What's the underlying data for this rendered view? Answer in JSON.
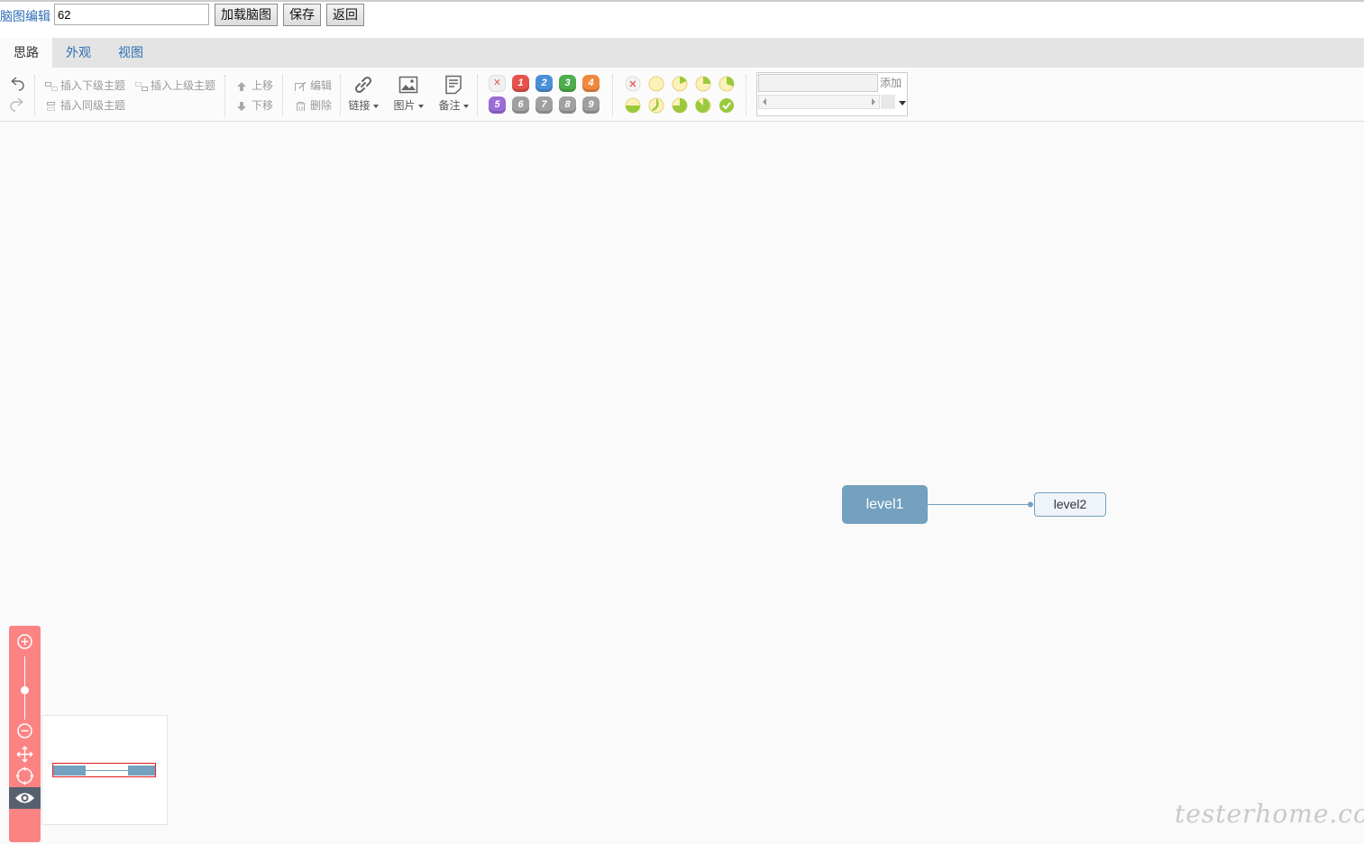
{
  "header": {
    "title": "脑图编辑",
    "id_value": "62",
    "load_button": "加载脑图",
    "save_button": "保存",
    "back_button": "返回"
  },
  "tabs": [
    {
      "label": "思路",
      "active": true
    },
    {
      "label": "外观",
      "active": false
    },
    {
      "label": "视图",
      "active": false
    }
  ],
  "toolbar": {
    "insert_child": "插入下级主题",
    "insert_parent": "插入上级主题",
    "insert_sibling": "插入同级主题",
    "move_up": "上移",
    "move_down": "下移",
    "edit": "编辑",
    "delete": "删除",
    "link": "链接",
    "image": "图片",
    "note": "备注",
    "priorities": [
      "1",
      "2",
      "3",
      "4",
      "5",
      "6",
      "7",
      "8",
      "9"
    ],
    "template_add": "添加"
  },
  "canvas": {
    "root_node": "level1",
    "child_node": "level2"
  },
  "watermark": "testerhome.com",
  "colors": {
    "accent": "#2e6fb5",
    "node_root": "#73a1bf",
    "zoom_panel": "#fc8383",
    "priority": [
      "#e7514b",
      "#4a90d9",
      "#4cae4c",
      "#f0883e",
      "#9b6bd6",
      "#a0a0a0",
      "#a0a0a0",
      "#a0a0a0",
      "#a0a0a0"
    ]
  }
}
